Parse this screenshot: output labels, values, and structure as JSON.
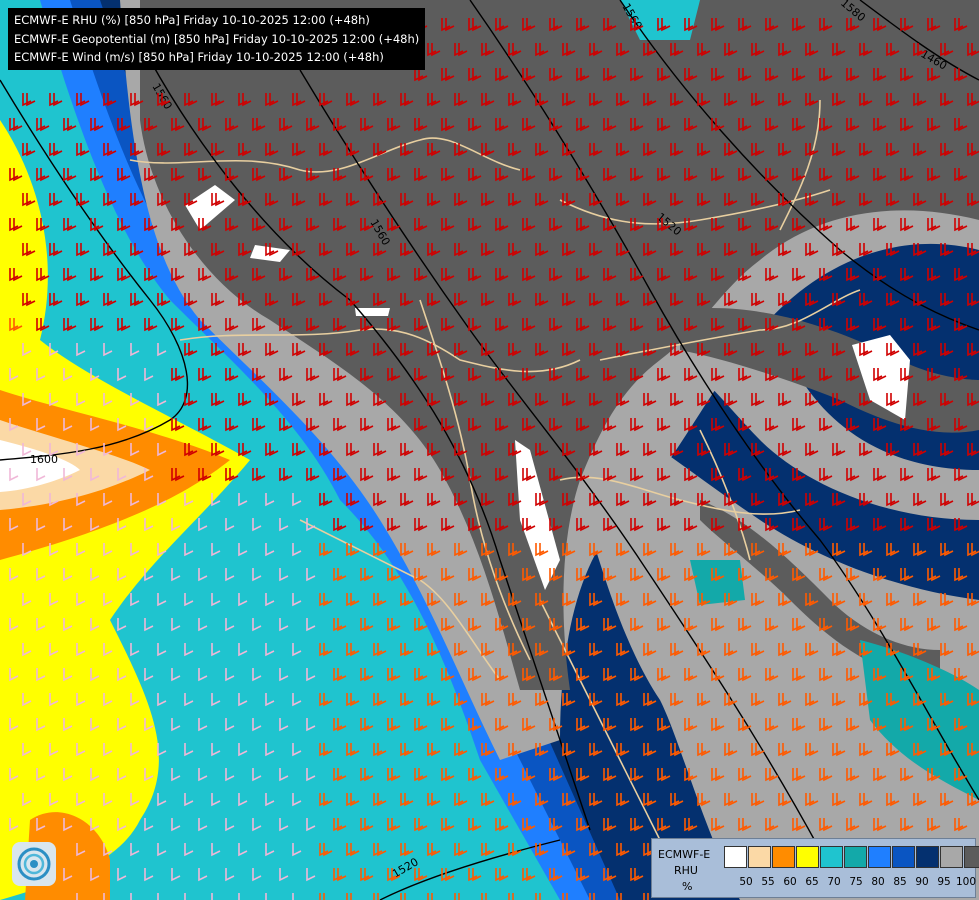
{
  "titles": [
    "ECMWF-E RHU (%) [850 hPa] Friday 10-10-2025 12:00 (+48h)",
    "ECMWF-E Geopotential (m) [850 hPa] Friday 10-10-2025 12:00 (+48h)",
    "ECMWF-E Wind (m/s) [850 hPa] Friday 10-10-2025 12:00 (+48h)"
  ],
  "contours": {
    "labels": [
      "1600",
      "1560",
      "1560",
      "1520",
      "1560",
      "1460",
      "1580",
      "1520"
    ]
  },
  "legend": {
    "model": "ECMWF-E",
    "variable": "RHU",
    "unit": "%",
    "ticks": [
      "50",
      "55",
      "60",
      "65",
      "70",
      "75",
      "80",
      "85",
      "90",
      "95",
      "100"
    ],
    "colors": [
      "#ffffff",
      "#fbd9a6",
      "#ff8c00",
      "#ffff00",
      "#1fc4cf",
      "#13a9a9",
      "#1f7fff",
      "#0a55c2",
      "#04306f",
      "#a8a8a8",
      "#5c5c5c"
    ]
  },
  "colors": {
    "ocean_background": "#1fc4cf",
    "border_line": "#e8cfa0",
    "contour_line": "#000000",
    "barb_strong": "#d00000",
    "barb_medium": "#ff5a00",
    "barb_weak": "#f0b8d8"
  },
  "icons": {
    "logo": "ecmwf-swirl-logo-icon"
  }
}
